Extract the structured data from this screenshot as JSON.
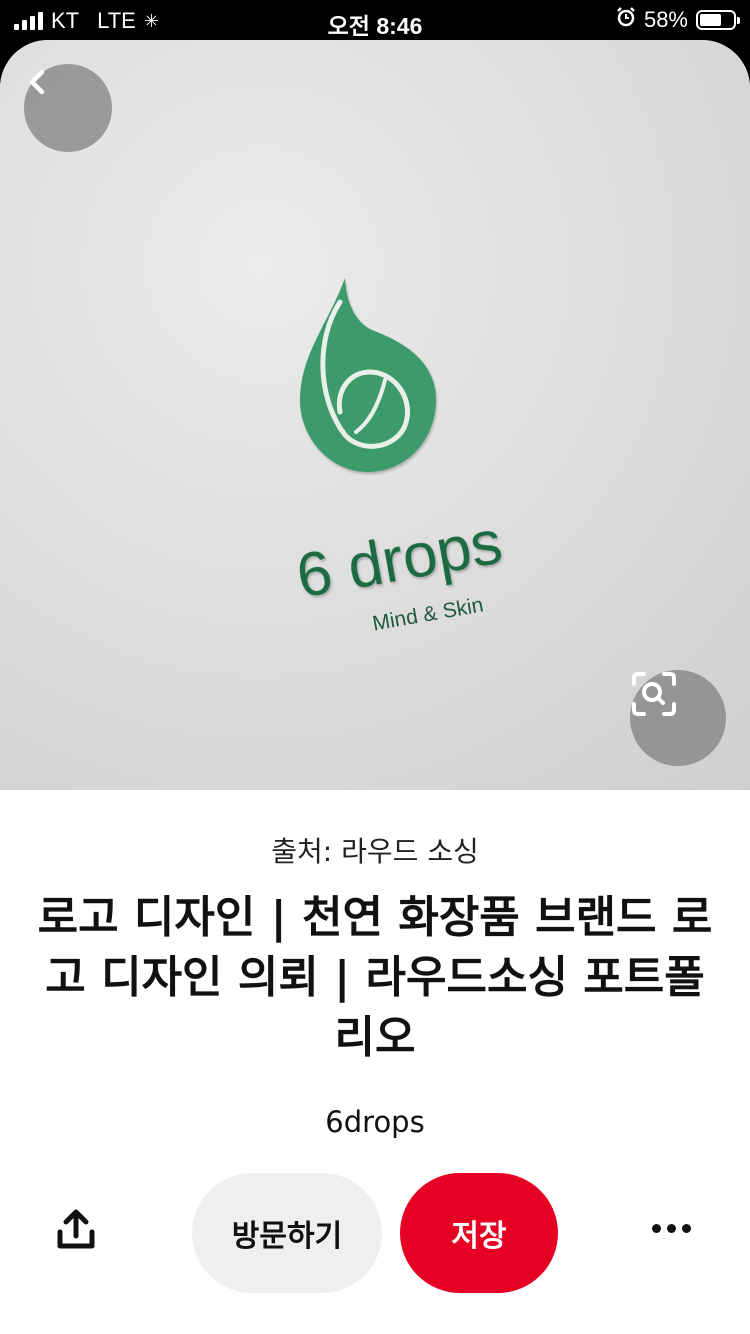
{
  "status_bar": {
    "carrier": "KT",
    "network": "LTE",
    "time": "오전 8:46",
    "battery_percent": "58%",
    "battery_level": 0.58
  },
  "pin": {
    "logo_text": "6 drops",
    "logo_tagline": "Mind & Skin",
    "source": "출처: 라우드 소싱",
    "title": "로고 디자인 | 천연 화장품 브랜드 로고 디자인 의뢰 | 라우드소싱 포트폴리오",
    "creator": "6drops"
  },
  "actions": {
    "visit_label": "방문하기",
    "save_label": "저장"
  },
  "icons": {
    "back": "chevron-left-icon",
    "lens": "visual-search-icon",
    "share": "share-icon",
    "more": "more-horizontal-icon"
  },
  "colors": {
    "accent": "#e60023",
    "logo_green": "#3e9a6a",
    "logo_text": "#1f6b43"
  }
}
